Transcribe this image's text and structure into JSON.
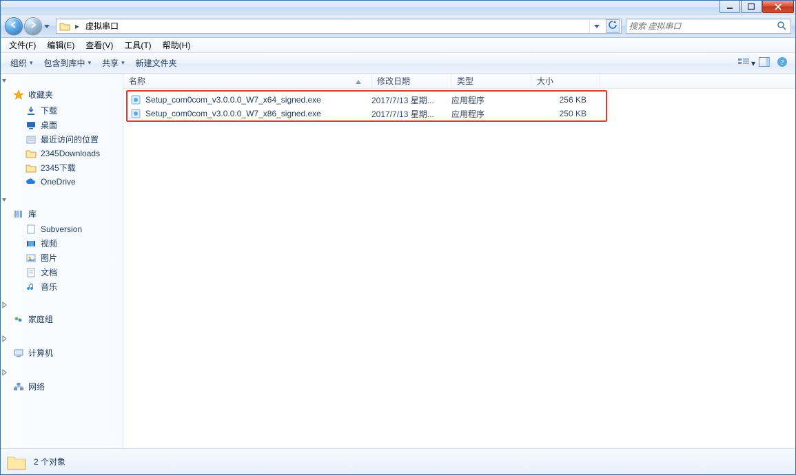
{
  "titlebar": {},
  "nav": {
    "crumb_root_arrow": "▸",
    "crumb": "虚拟串口",
    "search_placeholder": "搜索 虚拟串口"
  },
  "menubar": {
    "file": "文件(F)",
    "edit": "编辑(E)",
    "view": "查看(V)",
    "tools": "工具(T)",
    "help": "帮助(H)"
  },
  "toolbar": {
    "organize": "组织",
    "include": "包含到库中",
    "share": "共享",
    "newfolder": "新建文件夹"
  },
  "sidebar": {
    "favorites": "收藏夹",
    "fav_items": {
      "downloads": "下载",
      "desktop": "桌面",
      "recent": "最近访问的位置",
      "dl2345": "2345Downloads",
      "dl2345cn": "2345下载",
      "onedrive": "OneDrive"
    },
    "libraries": "库",
    "lib_items": {
      "subversion": "Subversion",
      "videos": "视频",
      "pictures": "图片",
      "documents": "文档",
      "music": "音乐"
    },
    "homegroup": "家庭组",
    "computer": "计算机",
    "network": "网络"
  },
  "columns": {
    "name": "名称",
    "date": "修改日期",
    "type": "类型",
    "size": "大小"
  },
  "files": [
    {
      "name": "Setup_com0com_v3.0.0.0_W7_x64_signed.exe",
      "date": "2017/7/13 星期...",
      "type": "应用程序",
      "size": "256 KB"
    },
    {
      "name": "Setup_com0com_v3.0.0.0_W7_x86_signed.exe",
      "date": "2017/7/13 星期...",
      "type": "应用程序",
      "size": "250 KB"
    }
  ],
  "status": {
    "count_text": "2 个对象"
  }
}
